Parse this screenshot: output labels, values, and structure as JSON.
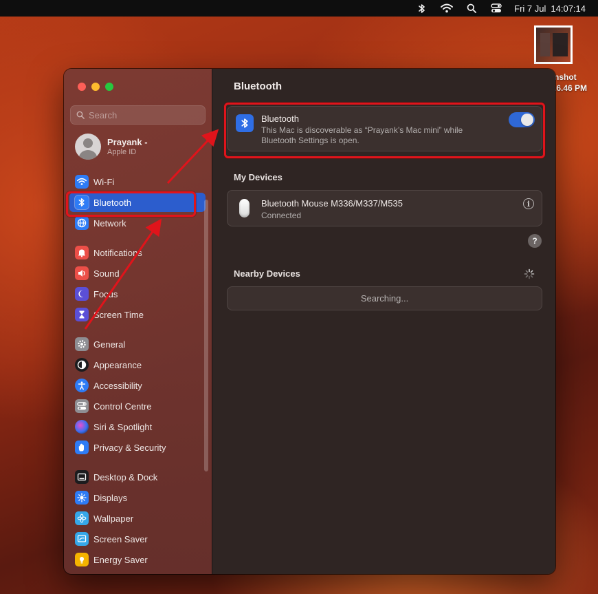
{
  "menubar": {
    "date": "Fri 7 Jul",
    "time": "14:07:14",
    "icons": [
      "bluetooth-icon",
      "wifi-icon",
      "search-icon",
      "control-centre-icon"
    ]
  },
  "desktop": {
    "screenshot_label_line1": "nshot",
    "screenshot_label_line2": ".6.46 PM"
  },
  "sidebar": {
    "search_placeholder": "Search",
    "account": {
      "name": "Prayank -",
      "subtitle": "Apple ID"
    },
    "items": [
      {
        "label": "Wi-Fi",
        "icon": "wifi-icon",
        "color": "#2e7cf6"
      },
      {
        "label": "Bluetooth",
        "icon": "bluetooth-icon",
        "color": "#2e7cf6",
        "selected": true
      },
      {
        "label": "Network",
        "icon": "globe-icon",
        "color": "#2e7cf6"
      },
      {
        "label": "Notifications",
        "icon": "bell-icon",
        "color": "#ec4f48"
      },
      {
        "label": "Sound",
        "icon": "speaker-icon",
        "color": "#ec4f48"
      },
      {
        "label": "Focus",
        "icon": "moon-icon",
        "color": "#5b4fd6"
      },
      {
        "label": "Screen Time",
        "icon": "hourglass-icon",
        "color": "#5b4fd6"
      },
      {
        "label": "General",
        "icon": "gear-icon",
        "color": "#8e8e93"
      },
      {
        "label": "Appearance",
        "icon": "appearance-icon",
        "color": "#1c1c1e"
      },
      {
        "label": "Accessibility",
        "icon": "accessibility-icon",
        "color": "#2e7cf6"
      },
      {
        "label": "Control Centre",
        "icon": "control-centre-icon",
        "color": "#8e8e93"
      },
      {
        "label": "Siri & Spotlight",
        "icon": "siri-icon",
        "color": "#3a3a5a"
      },
      {
        "label": "Privacy & Security",
        "icon": "hand-icon",
        "color": "#2e7cf6"
      },
      {
        "label": "Desktop & Dock",
        "icon": "dock-icon",
        "color": "#1c1c1e"
      },
      {
        "label": "Displays",
        "icon": "sun-icon",
        "color": "#2e7cf6"
      },
      {
        "label": "Wallpaper",
        "icon": "flower-icon",
        "color": "#36a7e8"
      },
      {
        "label": "Screen Saver",
        "icon": "screensaver-icon",
        "color": "#36a7e8"
      },
      {
        "label": "Energy Saver",
        "icon": "bulb-icon",
        "color": "#f5b400"
      }
    ]
  },
  "main": {
    "title": "Bluetooth",
    "bluetooth": {
      "label": "Bluetooth",
      "description": "This Mac is discoverable as “Prayank’s Mac mini” while Bluetooth Settings is open.",
      "enabled": true
    },
    "my_devices": {
      "title": "My Devices",
      "devices": [
        {
          "name": "Bluetooth Mouse M336/M337/M535",
          "status": "Connected"
        }
      ]
    },
    "nearby": {
      "title": "Nearby Devices",
      "status": "Searching..."
    }
  },
  "colors": {
    "accent": "#2c5dcd",
    "annotation": "#e0141b"
  }
}
